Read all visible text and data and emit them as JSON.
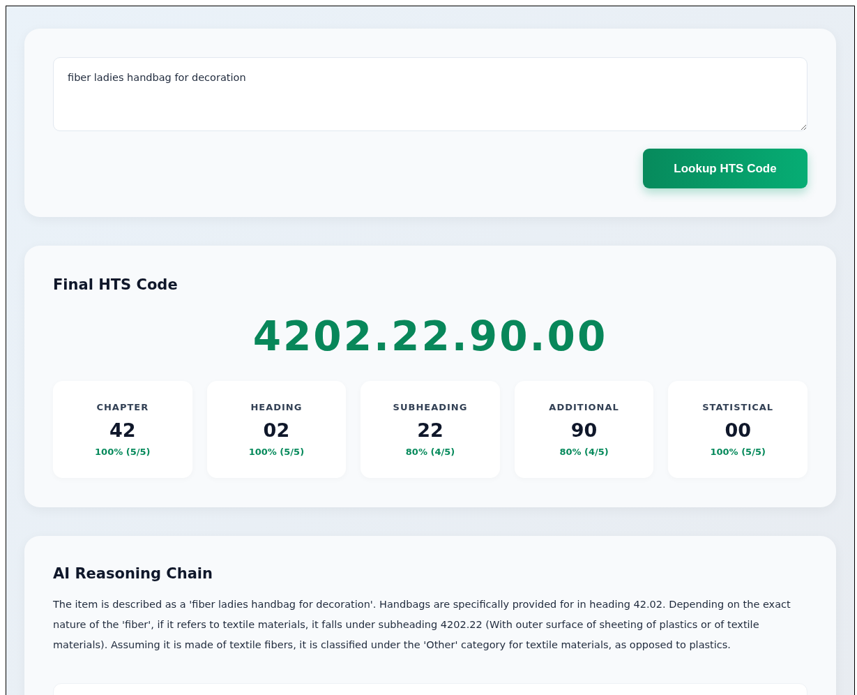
{
  "query": {
    "value": "fiber ladies handbag for decoration"
  },
  "lookup_button": {
    "label": "Lookup HTS Code"
  },
  "result": {
    "title": "Final HTS Code",
    "code": "4202.22.90.00",
    "segments": [
      {
        "label": "CHAPTER",
        "value": "42",
        "confidence": "100% (5/5)"
      },
      {
        "label": "HEADING",
        "value": "02",
        "confidence": "100% (5/5)"
      },
      {
        "label": "SUBHEADING",
        "value": "22",
        "confidence": "80% (4/5)"
      },
      {
        "label": "ADDITIONAL",
        "value": "90",
        "confidence": "80% (4/5)"
      },
      {
        "label": "STATISTICAL",
        "value": "00",
        "confidence": "100% (5/5)"
      }
    ]
  },
  "reasoning": {
    "title": "AI Reasoning Chain",
    "text": "The item is described as a 'fiber ladies handbag for decoration'. Handbags are specifically provided for in heading 42.02. Depending on the exact nature of the 'fiber', if it refers to textile materials, it falls under subheading 4202.22 (With outer surface of sheeting of plastics or of textile materials). Assuming it is made of textile fibers, it is classified under the 'Other' category for textile materials, as opposed to plastics."
  }
}
